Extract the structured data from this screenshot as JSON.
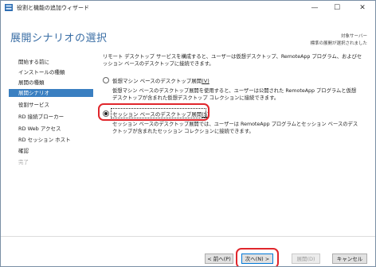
{
  "window": {
    "title": "役割と機能の追加ウィザード",
    "controls": {
      "minimize": "—",
      "maximize": "☐",
      "close": "✕"
    },
    "icon": "server-manager-icon"
  },
  "header": {
    "page_title": "展開シナリオの選択",
    "target_label": "対象サーバー",
    "target_value": "標準の展開が選択されました"
  },
  "sidebar": {
    "items": [
      {
        "label": "開始する前に",
        "state": "normal"
      },
      {
        "label": "インストールの種類",
        "state": "normal"
      },
      {
        "label": "展開の種類",
        "state": "normal"
      },
      {
        "label": "展開シナリオ",
        "state": "active"
      },
      {
        "label": "役割サービス",
        "state": "normal"
      },
      {
        "label": "RD 接続ブローカー",
        "state": "normal"
      },
      {
        "label": "RD Web アクセス",
        "state": "normal"
      },
      {
        "label": "RD セッション ホスト",
        "state": "normal"
      },
      {
        "label": "確認",
        "state": "normal"
      },
      {
        "label": "完了",
        "state": "disabled"
      }
    ]
  },
  "content": {
    "intro": "リモート デスクトップ サービスを構成すると、ユーザーは仮想デスクトップ、RemoteApp プログラム、およびセッション ベースのデスクトップに接続できます。",
    "options": [
      {
        "label": "仮想マシン ベースのデスクトップ展開",
        "accelerator": "(V)",
        "selected": false,
        "description": "仮想マシン ベースのデスクトップ展開を使用すると、ユーザーは公開された RemoteApp プログラムと仮想デスクトップが含まれた仮想デスクトップ コレクションに接続できます。"
      },
      {
        "label": "セッション ベースのデスクトップ展開",
        "accelerator": "(S)",
        "selected": true,
        "description": "セッション ベースのデスクトップ展開では、ユーザーは RemoteApp プログラムとセッション ベースのデスクトップが含まれたセッション コレクションに接続できます。"
      }
    ]
  },
  "footer": {
    "buttons": [
      {
        "label": "< 前へ(P)",
        "enabled": true
      },
      {
        "label": "次へ(N) >",
        "enabled": true
      },
      {
        "label": "展開(D)",
        "enabled": false
      },
      {
        "label": "キャンセル",
        "enabled": true
      }
    ]
  },
  "colors": {
    "accent": "#3a7fc1",
    "title_blue": "#3a6ea5",
    "highlight_red": "#e0262c"
  }
}
